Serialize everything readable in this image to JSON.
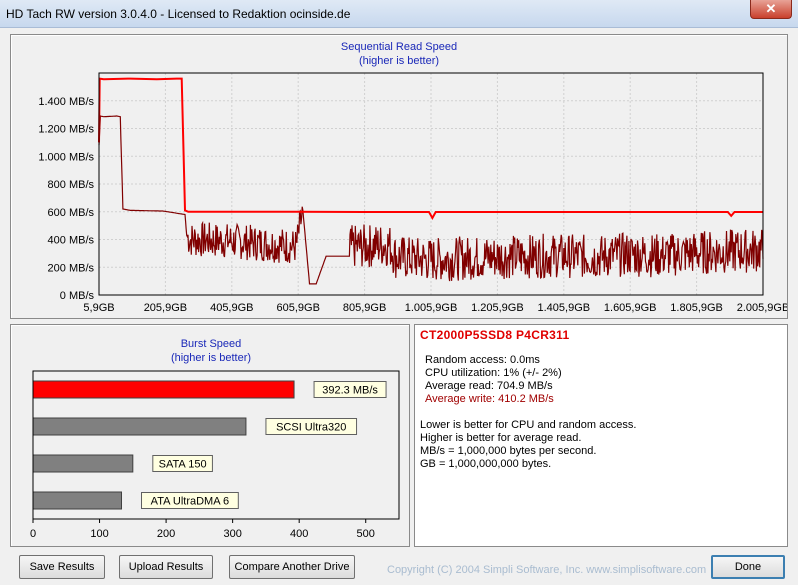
{
  "window": {
    "title": "HD Tach RW version 3.0.4.0 - Licensed to Redaktion ocinside.de",
    "close_label": "✕"
  },
  "colors": {
    "read_line": "#ff0000",
    "write_line": "#800000",
    "burst_main": "#ff0000",
    "burst_ref": "#808080",
    "info_title": "#e00000",
    "write_text": "#a00000"
  },
  "seq_chart": {
    "title": "Sequential Read Speed",
    "subtitle": "(higher is better)"
  },
  "burst_chart": {
    "title": "Burst Speed",
    "subtitle": "(higher is better)"
  },
  "chart_data": [
    {
      "type": "line",
      "title": "Sequential Read Speed",
      "subtitle": "(higher is better)",
      "x_unit": "GB",
      "y_unit": "MB/s",
      "ylim": [
        0,
        1600
      ],
      "xlim": [
        5.9,
        2005.9
      ],
      "y_ticks": [
        "0 MB/s",
        "200 MB/s",
        "400 MB/s",
        "600 MB/s",
        "800 MB/s",
        "1.000 MB/s",
        "1.200 MB/s",
        "1.400 MB/s"
      ],
      "x_ticks": [
        "5,9GB",
        "205,9GB",
        "405,9GB",
        "605,9GB",
        "805,9GB",
        "1.005,9GB",
        "1.205,9GB",
        "1.405,9GB",
        "1.605,9GB",
        "1.805,9GB",
        "2.005,9GB"
      ],
      "grid": true,
      "series": [
        {
          "color": "#ff0000",
          "x": [
            5.9,
            8,
            20,
            100,
            180,
            240,
            255,
            265,
            275,
            400,
            600,
            800,
            1000,
            1010,
            1020,
            1200,
            1400,
            1600,
            1800,
            1900,
            1910,
            1920,
            2005.9
          ],
          "y": [
            1100,
            1560,
            1555,
            1560,
            1555,
            1560,
            1560,
            610,
            600,
            600,
            600,
            598,
            598,
            555,
            598,
            598,
            598,
            598,
            598,
            598,
            570,
            598,
            598
          ]
        },
        {
          "color": "#800000",
          "x": [
            5.9,
            10,
            20,
            60,
            70,
            78,
            100,
            200,
            265,
            270,
            280,
            400,
            500,
            600,
            620,
            640,
            660,
            690,
            700,
            760,
            880,
            900,
            1000,
            1100,
            1200,
            1400,
            1500,
            1600,
            1700,
            1800,
            1900,
            2005.9
          ],
          "y": [
            1080,
            1290,
            1285,
            1290,
            1285,
            620,
            610,
            605,
            580,
            430,
            400,
            390,
            370,
            350,
            610,
            80,
            80,
            280,
            280,
            280,
            300,
            210,
            190,
            200,
            210,
            220,
            210,
            230,
            220,
            240,
            250,
            260
          ]
        }
      ]
    },
    {
      "type": "bar",
      "orientation": "horizontal",
      "title": "Burst Speed",
      "subtitle": "(higher is better)",
      "xlim": [
        0,
        550
      ],
      "x_ticks": [
        "0",
        "100",
        "200",
        "300",
        "400",
        "500"
      ],
      "categories": [
        "392.3 MB/s",
        "SCSI Ultra320",
        "SATA 150",
        "ATA UltraDMA 6"
      ],
      "values": [
        392.3,
        320,
        150,
        133
      ],
      "bar_colors": [
        "#ff0000",
        "#808080",
        "#808080",
        "#808080"
      ]
    }
  ],
  "info": {
    "drive_name": "CT2000P5SSD8 P4CR311",
    "random_access": "Random access: 0.0ms",
    "cpu_utilization": "CPU utilization: 1% (+/- 2%)",
    "average_read": "Average read: 704.9 MB/s",
    "average_write": "Average write: 410.2 MB/s",
    "note1": "Lower is better for CPU and random access.",
    "note2": "Higher is better for average read.",
    "note3": "MB/s = 1,000,000 bytes per second.",
    "note4": "GB = 1,000,000,000 bytes."
  },
  "buttons": {
    "save": "Save Results",
    "upload": "Upload Results",
    "compare": "Compare Another Drive",
    "done": "Done"
  },
  "copyright": "Copyright (C) 2004 Simpli Software, Inc. www.simplisoftware.com"
}
